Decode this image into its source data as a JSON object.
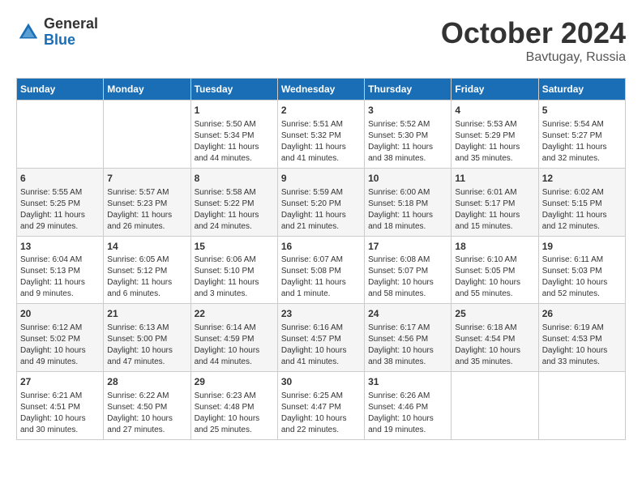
{
  "header": {
    "logo_general": "General",
    "logo_blue": "Blue",
    "month": "October 2024",
    "location": "Bavtugay, Russia"
  },
  "weekdays": [
    "Sunday",
    "Monday",
    "Tuesday",
    "Wednesday",
    "Thursday",
    "Friday",
    "Saturday"
  ],
  "weeks": [
    [
      {
        "day": "",
        "info": ""
      },
      {
        "day": "",
        "info": ""
      },
      {
        "day": "1",
        "info": "Sunrise: 5:50 AM\nSunset: 5:34 PM\nDaylight: 11 hours and 44 minutes."
      },
      {
        "day": "2",
        "info": "Sunrise: 5:51 AM\nSunset: 5:32 PM\nDaylight: 11 hours and 41 minutes."
      },
      {
        "day": "3",
        "info": "Sunrise: 5:52 AM\nSunset: 5:30 PM\nDaylight: 11 hours and 38 minutes."
      },
      {
        "day": "4",
        "info": "Sunrise: 5:53 AM\nSunset: 5:29 PM\nDaylight: 11 hours and 35 minutes."
      },
      {
        "day": "5",
        "info": "Sunrise: 5:54 AM\nSunset: 5:27 PM\nDaylight: 11 hours and 32 minutes."
      }
    ],
    [
      {
        "day": "6",
        "info": "Sunrise: 5:55 AM\nSunset: 5:25 PM\nDaylight: 11 hours and 29 minutes."
      },
      {
        "day": "7",
        "info": "Sunrise: 5:57 AM\nSunset: 5:23 PM\nDaylight: 11 hours and 26 minutes."
      },
      {
        "day": "8",
        "info": "Sunrise: 5:58 AM\nSunset: 5:22 PM\nDaylight: 11 hours and 24 minutes."
      },
      {
        "day": "9",
        "info": "Sunrise: 5:59 AM\nSunset: 5:20 PM\nDaylight: 11 hours and 21 minutes."
      },
      {
        "day": "10",
        "info": "Sunrise: 6:00 AM\nSunset: 5:18 PM\nDaylight: 11 hours and 18 minutes."
      },
      {
        "day": "11",
        "info": "Sunrise: 6:01 AM\nSunset: 5:17 PM\nDaylight: 11 hours and 15 minutes."
      },
      {
        "day": "12",
        "info": "Sunrise: 6:02 AM\nSunset: 5:15 PM\nDaylight: 11 hours and 12 minutes."
      }
    ],
    [
      {
        "day": "13",
        "info": "Sunrise: 6:04 AM\nSunset: 5:13 PM\nDaylight: 11 hours and 9 minutes."
      },
      {
        "day": "14",
        "info": "Sunrise: 6:05 AM\nSunset: 5:12 PM\nDaylight: 11 hours and 6 minutes."
      },
      {
        "day": "15",
        "info": "Sunrise: 6:06 AM\nSunset: 5:10 PM\nDaylight: 11 hours and 3 minutes."
      },
      {
        "day": "16",
        "info": "Sunrise: 6:07 AM\nSunset: 5:08 PM\nDaylight: 11 hours and 1 minute."
      },
      {
        "day": "17",
        "info": "Sunrise: 6:08 AM\nSunset: 5:07 PM\nDaylight: 10 hours and 58 minutes."
      },
      {
        "day": "18",
        "info": "Sunrise: 6:10 AM\nSunset: 5:05 PM\nDaylight: 10 hours and 55 minutes."
      },
      {
        "day": "19",
        "info": "Sunrise: 6:11 AM\nSunset: 5:03 PM\nDaylight: 10 hours and 52 minutes."
      }
    ],
    [
      {
        "day": "20",
        "info": "Sunrise: 6:12 AM\nSunset: 5:02 PM\nDaylight: 10 hours and 49 minutes."
      },
      {
        "day": "21",
        "info": "Sunrise: 6:13 AM\nSunset: 5:00 PM\nDaylight: 10 hours and 47 minutes."
      },
      {
        "day": "22",
        "info": "Sunrise: 6:14 AM\nSunset: 4:59 PM\nDaylight: 10 hours and 44 minutes."
      },
      {
        "day": "23",
        "info": "Sunrise: 6:16 AM\nSunset: 4:57 PM\nDaylight: 10 hours and 41 minutes."
      },
      {
        "day": "24",
        "info": "Sunrise: 6:17 AM\nSunset: 4:56 PM\nDaylight: 10 hours and 38 minutes."
      },
      {
        "day": "25",
        "info": "Sunrise: 6:18 AM\nSunset: 4:54 PM\nDaylight: 10 hours and 35 minutes."
      },
      {
        "day": "26",
        "info": "Sunrise: 6:19 AM\nSunset: 4:53 PM\nDaylight: 10 hours and 33 minutes."
      }
    ],
    [
      {
        "day": "27",
        "info": "Sunrise: 6:21 AM\nSunset: 4:51 PM\nDaylight: 10 hours and 30 minutes."
      },
      {
        "day": "28",
        "info": "Sunrise: 6:22 AM\nSunset: 4:50 PM\nDaylight: 10 hours and 27 minutes."
      },
      {
        "day": "29",
        "info": "Sunrise: 6:23 AM\nSunset: 4:48 PM\nDaylight: 10 hours and 25 minutes."
      },
      {
        "day": "30",
        "info": "Sunrise: 6:25 AM\nSunset: 4:47 PM\nDaylight: 10 hours and 22 minutes."
      },
      {
        "day": "31",
        "info": "Sunrise: 6:26 AM\nSunset: 4:46 PM\nDaylight: 10 hours and 19 minutes."
      },
      {
        "day": "",
        "info": ""
      },
      {
        "day": "",
        "info": ""
      }
    ]
  ]
}
